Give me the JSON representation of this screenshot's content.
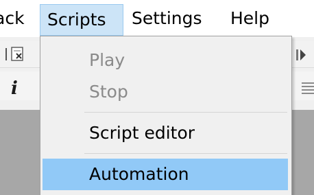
{
  "menubar": {
    "items": [
      {
        "label": "ack"
      },
      {
        "label": "Scripts"
      },
      {
        "label": "Settings"
      },
      {
        "label": "Help"
      }
    ]
  },
  "dropdown": {
    "items": [
      {
        "label": "Play",
        "enabled": false
      },
      {
        "label": "Stop",
        "enabled": false
      },
      {
        "label": "Script editor",
        "enabled": true
      },
      {
        "label": "Automation",
        "enabled": true,
        "selected": true
      }
    ]
  },
  "toolbar": {
    "icons": [
      "document-icon",
      "italic-icon",
      "play-icon",
      "align-lines-icon"
    ]
  },
  "colors": {
    "menu_highlight": "#cce4f7",
    "item_highlight": "#91c9f7",
    "workarea": "#a7a7a7",
    "menu_bg": "#f0f0f0"
  }
}
